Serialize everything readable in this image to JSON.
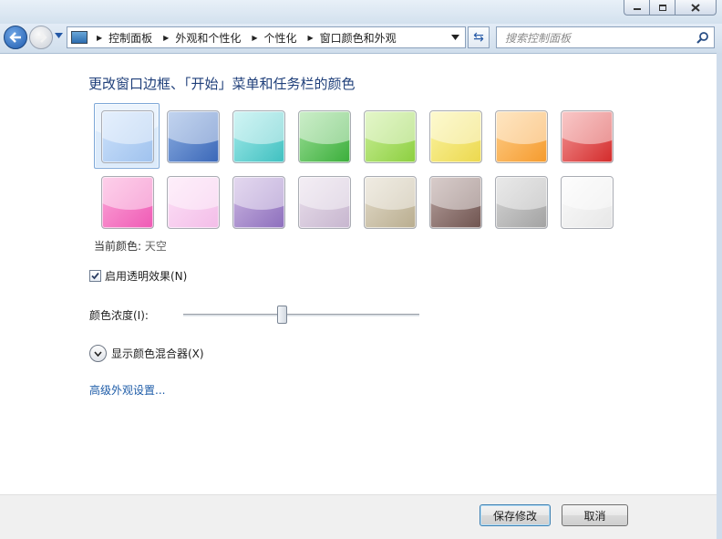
{
  "nav": {
    "breadcrumbs": [
      "控制面板",
      "外观和个性化",
      "个性化",
      "窗口颜色和外观"
    ],
    "search_placeholder": "搜索控制面板"
  },
  "main": {
    "title": "更改窗口边框、「开始」菜单和任务栏的颜色",
    "swatch_colors": [
      [
        "#cfe3fb",
        "#9fc2ee"
      ],
      [
        "#8fb0e2",
        "#3a67b8"
      ],
      [
        "#a8ecec",
        "#3fc0c0"
      ],
      [
        "#9fe09a",
        "#3aae3a"
      ],
      [
        "#cdf09c",
        "#8ccf3f"
      ],
      [
        "#fbf5a6",
        "#ecd84d"
      ],
      [
        "#ffd18e",
        "#f59a2c"
      ],
      [
        "#f49a9a",
        "#d32a2a"
      ],
      [
        "#fca9d9",
        "#ef5ab5"
      ],
      [
        "#fde2f7",
        "#f3bde8"
      ],
      [
        "#cdb8e2",
        "#8d6fbd"
      ],
      [
        "#eae0ec",
        "#c7b6cf"
      ],
      [
        "#e4ddcc",
        "#b9ad8f"
      ],
      [
        "#b9a3a0",
        "#6f5450"
      ],
      [
        "#d8d8d8",
        "#a2a2a2"
      ],
      [
        "#fbfbfb",
        "#e7e7e7"
      ]
    ],
    "selected_swatch": 0,
    "current_color_label": "当前颜色:",
    "current_color_value": "天空",
    "transparency_label": "启用透明效果(N)",
    "transparency_checked": true,
    "intensity_label": "颜色浓度(I):",
    "intensity_value": 0.42,
    "mixer_label": "显示颜色混合器(X)",
    "advanced_link": "高级外观设置..."
  },
  "footer": {
    "save_label": "保存修改",
    "cancel_label": "取消"
  }
}
